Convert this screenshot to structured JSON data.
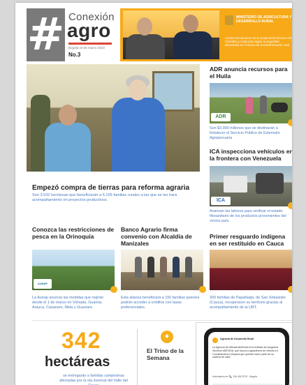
{
  "header": {
    "brand_top": "Conexión",
    "brand_main": "agro",
    "date": "Bogotá 10 de marzo 2023",
    "issue": "No.3",
    "ministry": "MINISTERIO DE AGRICULTURA Y DESARROLLO RURAL",
    "ministry_desc": "Conoce los alcances de la cooperación técnica entre Colombia y Cuba para lograr la seguridad alimentaria en el marco de la transformación rural",
    "colors": {
      "accent": "#f7a918",
      "hash_bg": "#7a7a7a",
      "link": "#4a7bbf"
    }
  },
  "main_story": {
    "title": "Empezó compra de tierras para reforma agraria",
    "summary": "Son 3.532 hectáreas que beneficiarán a 6.195 familias rurales a las que se les hará acompañamiento en proyectos productivos."
  },
  "right_stories": [
    {
      "title": "ADR anuncia recursos para el Huila",
      "badge": "ADR",
      "summary": "Son $3.000 millones que se destinarán a fortalecer el Servicio Público de Extensión Agropecuaria"
    },
    {
      "title": "ICA inspecciona vehículos en la frontera con Venezuela",
      "badge": "ICA",
      "summary": "Avanzan las labores para verificar el estado fitosanitario de los productos provenientes del vecino país."
    },
    {
      "title": "Primer resguardo indígena en ser restituido en Cauca",
      "summary": "309 familias de Papallaqta, de San Sebastián (Cauca), recuperaron su territorio gracias al acompañamiento de la URT."
    }
  ],
  "mid_stories": [
    {
      "title": "Conozca las restricciones de pesca en la Orinoquía",
      "badge": "AUNAP",
      "summary": "La Aunap anuncia las medidas que regirán desde el 1 de marzo en Vichada, Guainía, Arauca, Casanare, Meta y Guaviare."
    },
    {
      "title": "Banco Agrario firma convenio con Alcaldía de Manizales",
      "summary": "Esta alianza beneficiará a 150 familias quienes podrán acceder a créditos con tasas preferenciales."
    }
  ],
  "bottom": {
    "big_number": "342",
    "big_label": "hectáreas",
    "big_summary": "se entregarán a familias campesinas afectadas por la ola invernal del Valle del Cauca",
    "trino_title": "El Trino de la Semana",
    "tweet": {
      "account": "Agencia de Desarrollo Rural",
      "text": "La Agencia de #DesarrolloRural es la entidad del programa Sembrar #DEVIDA, que busca a agricultores de cebolla en Cundinamarca y Boyacá que quieran hacer parte de su cadena de valor.",
      "footer": "Información en: 📞 316 452 8720 · Bogotá"
    }
  }
}
